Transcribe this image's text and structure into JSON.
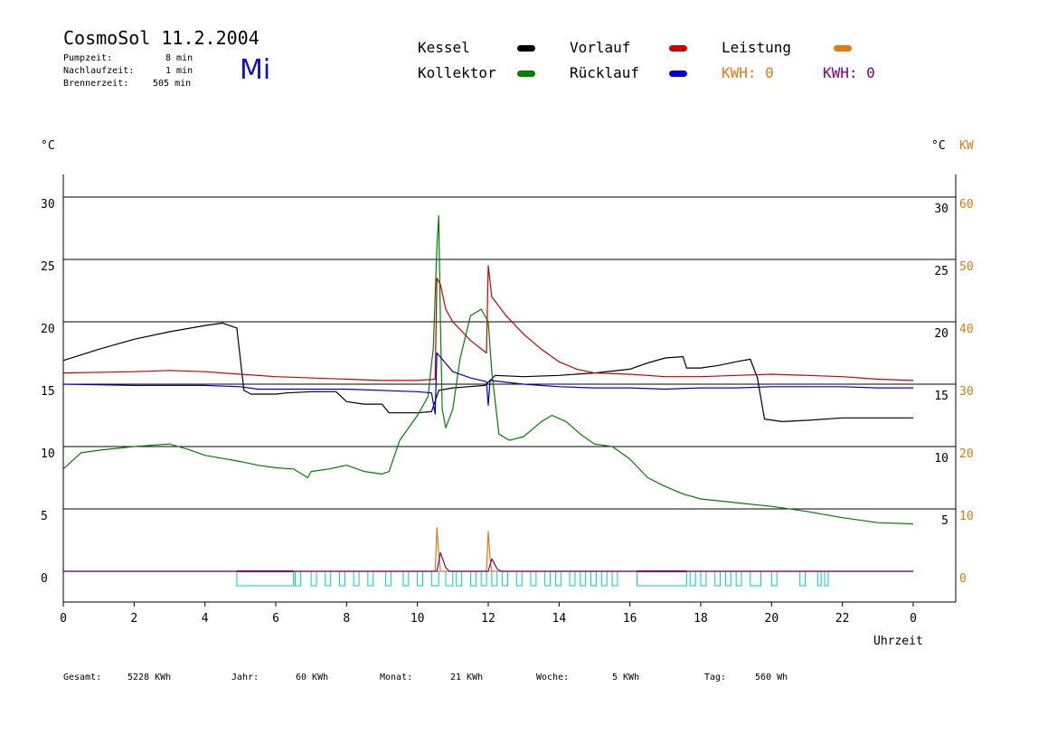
{
  "header": {
    "title": "CosmoSol 11.2.2004",
    "pumpzeit_label": "Pumpzeit:",
    "pumpzeit_value": "8 min",
    "nachlaufzeit_label": "Nachlaufzeit:",
    "nachlaufzeit_value": "1 min",
    "brennerzeit_label": "Brennerzeit:",
    "brennerzeit_value": "505 min",
    "weekday": "Mi"
  },
  "legend": {
    "kessel": "Kessel",
    "kollektor": "Kollektor",
    "vorlauf": "Vorlauf",
    "ruecklauf": "Rücklauf",
    "leistung": "Leistung",
    "kwh1": "KWH: 0",
    "kwh2": "KWH: 0"
  },
  "colors": {
    "kessel": "#000000",
    "kollektor": "#008000",
    "vorlauf": "#cc0000",
    "ruecklauf": "#0000cc",
    "leistung": "#e87810",
    "kwh2": "#800080",
    "pump": "#00cccc"
  },
  "axes": {
    "left_unit": "°C",
    "right_unit_c": "°C",
    "right_unit_kw": "KW",
    "xlabel": "Uhrzeit"
  },
  "footer": {
    "gesamt_label": "Gesamt:",
    "gesamt_value": "5228 KWh",
    "jahr_label": "Jahr:",
    "jahr_value": "60 KWh",
    "monat_label": "Monat:",
    "monat_value": "21 KWh",
    "woche_label": "Woche:",
    "woche_value": "5 KWh",
    "tag_label": "Tag:",
    "tag_value": "560 Wh"
  },
  "chart_data": {
    "type": "line",
    "x_range": [
      0,
      24
    ],
    "x_ticks": [
      "0",
      "2",
      "4",
      "6",
      "8",
      "10",
      "12",
      "14",
      "16",
      "18",
      "20",
      "22",
      "0"
    ],
    "y_range_left": [
      -2.5,
      35
    ],
    "y_ticks_left": [
      "0",
      "5",
      "10",
      "15",
      "20",
      "25",
      "30"
    ],
    "y_ticks_right_c": [
      "5",
      "10",
      "15",
      "20",
      "25",
      "30"
    ],
    "y_ticks_right_kw": [
      "0",
      "10",
      "20",
      "30",
      "40",
      "50",
      "60"
    ],
    "grid_y": [
      5,
      10,
      15,
      20,
      25,
      30
    ],
    "series": [
      {
        "name": "Kessel",
        "color": "#000000",
        "points": [
          [
            0,
            16.9
          ],
          [
            1,
            17.8
          ],
          [
            2,
            18.6
          ],
          [
            3,
            19.2
          ],
          [
            4,
            19.7
          ],
          [
            4.5,
            19.9
          ],
          [
            4.9,
            19.5
          ],
          [
            5.1,
            14.5
          ],
          [
            5.3,
            14.2
          ],
          [
            6,
            14.2
          ],
          [
            6.3,
            14.3
          ],
          [
            7,
            14.4
          ],
          [
            7.7,
            14.4
          ],
          [
            8,
            13.6
          ],
          [
            8.5,
            13.4
          ],
          [
            9,
            13.4
          ],
          [
            9.2,
            12.7
          ],
          [
            10,
            12.7
          ],
          [
            10.4,
            12.8
          ],
          [
            10.6,
            14.5
          ],
          [
            11,
            14.7
          ],
          [
            11.9,
            14.9
          ],
          [
            12.2,
            15.7
          ],
          [
            13,
            15.6
          ],
          [
            14,
            15.7
          ],
          [
            15,
            15.9
          ],
          [
            16,
            16.2
          ],
          [
            16.5,
            16.7
          ],
          [
            17,
            17.1
          ],
          [
            17.5,
            17.2
          ],
          [
            17.6,
            16.3
          ],
          [
            18,
            16.3
          ],
          [
            18.5,
            16.5
          ],
          [
            19,
            16.8
          ],
          [
            19.4,
            17.0
          ],
          [
            19.6,
            15.5
          ],
          [
            19.8,
            12.2
          ],
          [
            20.3,
            12.0
          ],
          [
            21,
            12.1
          ],
          [
            22,
            12.3
          ],
          [
            23,
            12.3
          ],
          [
            24,
            12.3
          ]
        ]
      },
      {
        "name": "Kollektor",
        "color": "#008000",
        "points": [
          [
            0,
            8.2
          ],
          [
            0.5,
            9.5
          ],
          [
            1,
            9.7
          ],
          [
            2,
            10.0
          ],
          [
            3,
            10.2
          ],
          [
            3.5,
            9.8
          ],
          [
            4,
            9.3
          ],
          [
            5,
            8.8
          ],
          [
            5.5,
            8.5
          ],
          [
            6,
            8.3
          ],
          [
            6.5,
            8.2
          ],
          [
            6.9,
            7.5
          ],
          [
            7,
            8.0
          ],
          [
            7.5,
            8.2
          ],
          [
            8,
            8.5
          ],
          [
            8.5,
            8.0
          ],
          [
            9,
            7.8
          ],
          [
            9.2,
            8.0
          ],
          [
            9.5,
            10.5
          ],
          [
            10,
            12.5
          ],
          [
            10.3,
            14.0
          ],
          [
            10.45,
            18.0
          ],
          [
            10.55,
            26.0
          ],
          [
            10.6,
            28.5
          ],
          [
            10.65,
            20.0
          ],
          [
            10.7,
            13.0
          ],
          [
            10.8,
            11.5
          ],
          [
            11,
            13.0
          ],
          [
            11.2,
            17.0
          ],
          [
            11.5,
            20.5
          ],
          [
            11.8,
            21.0
          ],
          [
            12,
            20.0
          ],
          [
            12.1,
            16.0
          ],
          [
            12.3,
            11.0
          ],
          [
            12.6,
            10.5
          ],
          [
            13,
            10.8
          ],
          [
            13.5,
            12.0
          ],
          [
            13.8,
            12.5
          ],
          [
            14.2,
            12.0
          ],
          [
            14.6,
            11.0
          ],
          [
            15,
            10.2
          ],
          [
            15.5,
            10.0
          ],
          [
            16,
            9.0
          ],
          [
            16.5,
            7.5
          ],
          [
            17,
            6.8
          ],
          [
            17.5,
            6.2
          ],
          [
            18,
            5.8
          ],
          [
            19,
            5.5
          ],
          [
            20,
            5.2
          ],
          [
            21,
            4.8
          ],
          [
            22,
            4.3
          ],
          [
            23,
            3.9
          ],
          [
            24,
            3.8
          ]
        ]
      },
      {
        "name": "Vorlauf",
        "color": "#cc0000",
        "points": [
          [
            0,
            15.9
          ],
          [
            2,
            16.0
          ],
          [
            3,
            16.1
          ],
          [
            4,
            16.0
          ],
          [
            5,
            15.8
          ],
          [
            6,
            15.6
          ],
          [
            8,
            15.4
          ],
          [
            9,
            15.3
          ],
          [
            10,
            15.3
          ],
          [
            10.5,
            15.4
          ],
          [
            10.55,
            23.5
          ],
          [
            10.65,
            23.0
          ],
          [
            10.8,
            21.0
          ],
          [
            11,
            20.0
          ],
          [
            11.5,
            18.5
          ],
          [
            11.95,
            17.5
          ],
          [
            12,
            24.5
          ],
          [
            12.1,
            22.0
          ],
          [
            12.5,
            20.5
          ],
          [
            13,
            19.0
          ],
          [
            13.5,
            17.8
          ],
          [
            14,
            16.8
          ],
          [
            14.5,
            16.2
          ],
          [
            15,
            15.9
          ],
          [
            16,
            15.8
          ],
          [
            17,
            15.6
          ],
          [
            18,
            15.6
          ],
          [
            19,
            15.7
          ],
          [
            20,
            15.8
          ],
          [
            21,
            15.7
          ],
          [
            22,
            15.6
          ],
          [
            23,
            15.4
          ],
          [
            24,
            15.3
          ]
        ]
      },
      {
        "name": "Rücklauf",
        "color": "#0000cc",
        "points": [
          [
            0,
            15.0
          ],
          [
            2,
            14.9
          ],
          [
            4,
            14.9
          ],
          [
            5,
            14.8
          ],
          [
            5.5,
            14.6
          ],
          [
            6,
            14.6
          ],
          [
            8,
            14.6
          ],
          [
            10,
            14.4
          ],
          [
            10.4,
            14.3
          ],
          [
            10.5,
            12.6
          ],
          [
            10.55,
            17.5
          ],
          [
            10.7,
            17.0
          ],
          [
            11,
            16.0
          ],
          [
            11.5,
            15.5
          ],
          [
            11.95,
            15.2
          ],
          [
            12,
            13.3
          ],
          [
            12.05,
            15.3
          ],
          [
            13,
            15.0
          ],
          [
            14,
            14.8
          ],
          [
            15,
            14.7
          ],
          [
            16,
            14.7
          ],
          [
            17,
            14.6
          ],
          [
            18,
            14.7
          ],
          [
            19,
            14.7
          ],
          [
            20,
            14.8
          ],
          [
            21,
            14.8
          ],
          [
            22,
            14.8
          ],
          [
            23,
            14.7
          ],
          [
            24,
            14.7
          ]
        ]
      },
      {
        "name": "Leistung",
        "color": "#e87810",
        "points": [
          [
            0,
            0
          ],
          [
            10.5,
            0
          ],
          [
            10.55,
            3.5
          ],
          [
            10.6,
            1.5
          ],
          [
            10.65,
            0
          ],
          [
            11.95,
            0
          ],
          [
            12.0,
            3.2
          ],
          [
            12.05,
            1.0
          ],
          [
            12.1,
            0
          ],
          [
            24,
            0
          ]
        ]
      },
      {
        "name": "KWH",
        "color": "#800080",
        "points": [
          [
            0,
            0
          ],
          [
            10.55,
            0
          ],
          [
            10.65,
            1.5
          ],
          [
            10.8,
            0.3
          ],
          [
            10.9,
            0
          ],
          [
            12.0,
            0
          ],
          [
            12.1,
            1.0
          ],
          [
            12.25,
            0.2
          ],
          [
            12.35,
            0
          ],
          [
            24,
            0
          ]
        ]
      }
    ],
    "pump_blocks": [
      [
        4.9,
        6.5
      ],
      [
        6.55,
        6.7
      ],
      [
        7.0,
        7.15
      ],
      [
        7.4,
        7.55
      ],
      [
        7.8,
        7.95
      ],
      [
        8.2,
        8.35
      ],
      [
        8.6,
        8.75
      ],
      [
        9.1,
        9.25
      ],
      [
        9.6,
        9.75
      ],
      [
        10.0,
        10.15
      ],
      [
        10.4,
        10.6
      ],
      [
        10.8,
        11.0
      ],
      [
        11.1,
        11.25
      ],
      [
        11.5,
        11.65
      ],
      [
        11.8,
        11.95
      ],
      [
        12.1,
        12.25
      ],
      [
        12.4,
        12.55
      ],
      [
        12.8,
        12.95
      ],
      [
        13.2,
        13.35
      ],
      [
        13.6,
        13.75
      ],
      [
        13.9,
        14.05
      ],
      [
        14.3,
        14.45
      ],
      [
        14.6,
        14.75
      ],
      [
        14.9,
        15.05
      ],
      [
        15.2,
        15.35
      ],
      [
        15.5,
        15.65
      ],
      [
        16.2,
        17.6
      ],
      [
        17.7,
        17.85
      ],
      [
        18.0,
        18.15
      ],
      [
        18.4,
        18.55
      ],
      [
        18.7,
        18.85
      ],
      [
        19.0,
        19.15
      ],
      [
        19.4,
        19.7
      ],
      [
        20.0,
        20.15
      ],
      [
        20.8,
        20.95
      ],
      [
        21.3,
        21.4
      ],
      [
        21.5,
        21.6
      ]
    ],
    "brenner_blocks": [
      [
        4.9,
        6.5
      ],
      [
        16.2,
        17.6
      ]
    ]
  }
}
